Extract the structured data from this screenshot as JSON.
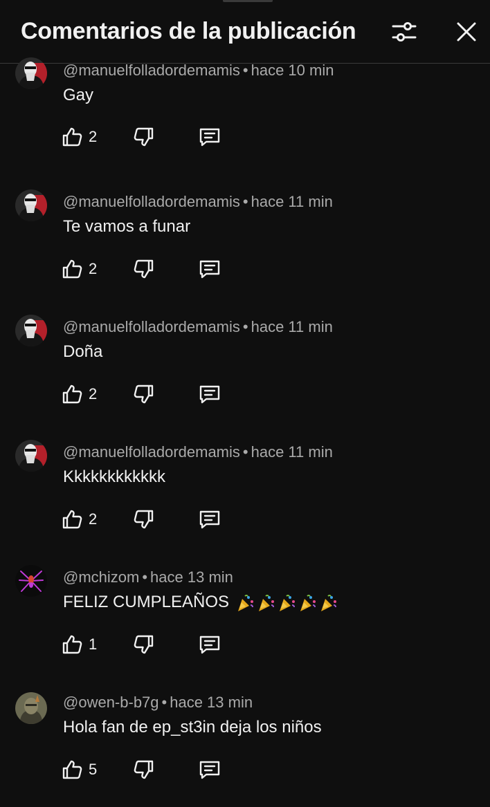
{
  "header": {
    "title": "Comentarios de la publicación",
    "filter_icon": "sliders-icon",
    "close_icon": "close-icon"
  },
  "comments": [
    {
      "author": "@manuelfolladordemamis",
      "time": "hace 10 min",
      "text": "Gay",
      "likes": "2",
      "avatar": "masked-figure"
    },
    {
      "author": "@manuelfolladordemamis",
      "time": "hace 11 min",
      "text": "Te vamos a funar",
      "likes": "2",
      "avatar": "masked-figure"
    },
    {
      "author": "@manuelfolladordemamis",
      "time": "hace 11 min",
      "text": "Doña",
      "likes": "2",
      "avatar": "masked-figure"
    },
    {
      "author": "@manuelfolladordemamis",
      "time": "hace 11 min",
      "text": "Kkkkkkkkkkkk",
      "likes": "2",
      "avatar": "masked-figure"
    },
    {
      "author": "@mchizom",
      "time": "hace 13 min",
      "text": "FELIZ CUMPLEAÑOS",
      "emoji_count": 5,
      "emoji": "party-popper",
      "likes": "1",
      "avatar": "spider-emblem"
    },
    {
      "author": "@owen-b-b7g",
      "time": "hace 13 min",
      "text": "Hola fan de ep_st3in deja los niños",
      "likes": "5",
      "avatar": "hooded-figure"
    }
  ],
  "icons": {
    "like": "thumbs-up-icon",
    "dislike": "thumbs-down-icon",
    "reply": "reply-comment-icon"
  },
  "colors": {
    "background": "#0f0f0f",
    "text_primary": "#f1f1f1",
    "text_secondary": "#aaaaaa"
  }
}
